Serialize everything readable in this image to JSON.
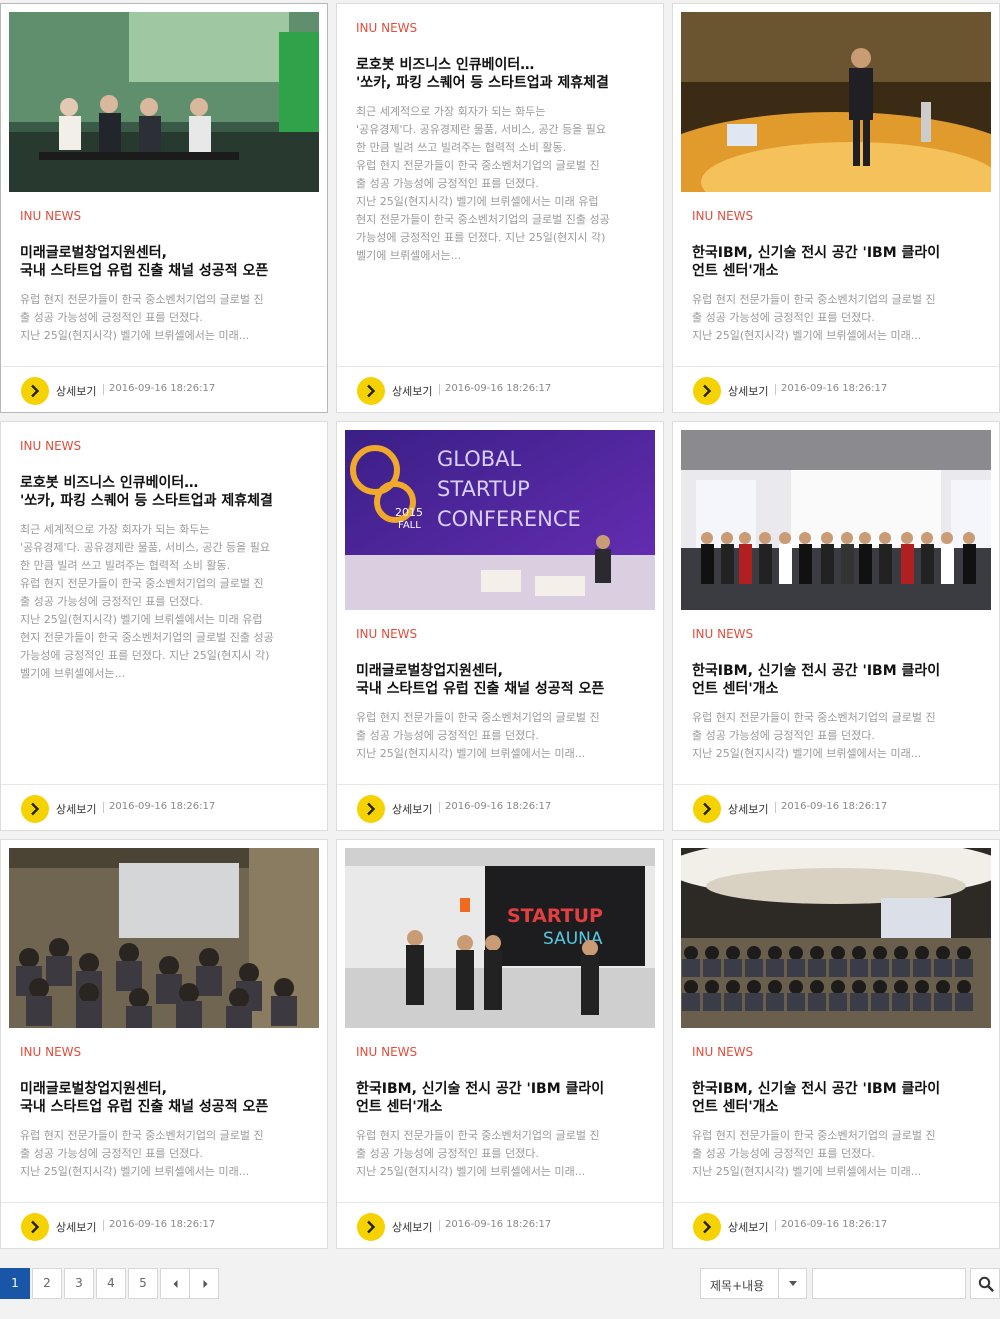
{
  "colors": {
    "accent": "#e24d3c",
    "more_button": "#f6d200",
    "pager_active": "#1a56a8"
  },
  "cards": [
    {
      "category": "INU NEWS",
      "title": [
        "미래글로벌창업지원센터,",
        "국내 스타트업 유럽 진출 채널 성공적 오픈"
      ],
      "desc": [
        "유럽 현지 전문가들이 한국 중소벤처기업의 글로벌 진",
        "출 성공 가능성에 긍정적인 표를 던졌다.",
        "지난 25일(현지시각) 벨기에 브뤼셀에서는 미래..."
      ],
      "more_label": "상세보기",
      "date": "2016-09-16 18:26:17",
      "image": "conference-panel-photo",
      "has_image": true
    },
    {
      "category": "INU NEWS",
      "title": [
        "로호봇 비즈니스 인큐베이터…",
        "'쏘카, 파킹 스퀘어 등 스타트업과 제휴체결"
      ],
      "desc": [
        "최근 세계적으로 가장 회자가 되는 화두는",
        "'공유경제'다. 공유경제란 물품, 서비스, 공간 등을 필요",
        "한 만큼 빌려 쓰고 빌려주는 협력적 소비 활동.",
        "유럽 현지 전문가들이 한국 중소벤처기업의 글로벌 진",
        "출 성공 가능성에 긍정적인 표를 던졌다.",
        "지난 25일(현지시각) 벨기에 브뤼셀에서는 미래 유럽",
        "현지 전문가들이 한국 중소벤처기업의 글로벌 진출 성공",
        "가능성에 긍정적인 표를 던졌다. 지난 25일(현지시 각)",
        "벨기에 브뤼셀에서는..."
      ],
      "more_label": "상세보기",
      "date": "2016-09-16 18:26:17",
      "has_image": false
    },
    {
      "category": "INU NEWS",
      "title": [
        "한국IBM, 신기술 전시 공간 'IBM 클라이",
        "언트 센터'개소"
      ],
      "desc": [
        "유럽 현지 전문가들이 한국 중소벤처기업의 글로벌 진",
        "출 성공 가능성에 긍정적인 표를 던졌다.",
        "지난 25일(현지시각) 벨기에 브뤼셀에서는 미래..."
      ],
      "more_label": "상세보기",
      "date": "2016-09-16 18:26:17",
      "image": "speaker-stage-photo",
      "has_image": true
    },
    {
      "category": "INU NEWS",
      "title": [
        "로호봇 비즈니스 인큐베이터…",
        "'쏘카, 파킹 스퀘어 등 스타트업과 제휴체결"
      ],
      "desc": [
        "최근 세계적으로 가장 회자가 되는 화두는",
        "'공유경제'다. 공유경제란 물품, 서비스, 공간 등을 필요",
        "한 만큼 빌려 쓰고 빌려주는 협력적 소비 활동.",
        "유럽 현지 전문가들이 한국 중소벤처기업의 글로벌 진",
        "출 성공 가능성에 긍정적인 표를 던졌다.",
        "지난 25일(현지시각) 벨기에 브뤼셀에서는 미래 유럽",
        "현지 전문가들이 한국 중소벤처기업의 글로벌 진출 성공",
        "가능성에 긍정적인 표를 던졌다. 지난 25일(현지시 각)",
        "벨기에 브뤼셀에서는..."
      ],
      "more_label": "상세보기",
      "date": "2016-09-16 18:26:17",
      "has_image": false
    },
    {
      "category": "INU NEWS",
      "title": [
        "미래글로벌창업지원센터,",
        "국내 스타트업 유럽 진출 채널 성공적 오픈"
      ],
      "desc": [
        "유럽 현지 전문가들이 한국 중소벤처기업의 글로벌 진",
        "출 성공 가능성에 긍정적인 표를 던졌다.",
        "지난 25일(현지시각) 벨기에 브뤼셀에서는 미래..."
      ],
      "more_label": "상세보기",
      "date": "2016-09-16 18:26:17",
      "image": "global-startup-conference-photo",
      "has_image": true,
      "image_text": {
        "line1": "GLOBAL",
        "line2": "STARTUP",
        "line3": "CONFERENCE",
        "year": "2015",
        "season": "FALL"
      }
    },
    {
      "category": "INU NEWS",
      "title": [
        "한국IBM, 신기술 전시 공간 'IBM 클라이",
        "언트 센터'개소"
      ],
      "desc": [
        "유럽 현지 전문가들이 한국 중소벤처기업의 글로벌 진",
        "출 성공 가능성에 긍정적인 표를 던졌다.",
        "지난 25일(현지시각) 벨기에 브뤼셀에서는 미래..."
      ],
      "more_label": "상세보기",
      "date": "2016-09-16 18:26:17",
      "image": "tencent-group-photo",
      "has_image": true
    },
    {
      "category": "INU NEWS",
      "title": [
        "미래글로벌창업지원센터,",
        "국내 스타트업 유럽 진출 채널 성공적 오픈"
      ],
      "desc": [
        "유럽 현지 전문가들이 한국 중소벤처기업의 글로벌 진",
        "출 성공 가능성에 긍정적인 표를 던졌다.",
        "지난 25일(현지시각) 벨기에 브뤼셀에서는 미래..."
      ],
      "more_label": "상세보기",
      "date": "2016-09-16 18:26:17",
      "image": "seminar-audience-photo",
      "has_image": true
    },
    {
      "category": "INU NEWS",
      "title": [
        "한국IBM, 신기술 전시 공간 'IBM 클라이",
        "언트 센터'개소"
      ],
      "desc": [
        "유럽 현지 전문가들이 한국 중소벤처기업의 글로벌 진",
        "출 성공 가능성에 긍정적인 표를 던졌다.",
        "지난 25일(현지시각) 벨기에 브뤼셀에서는 미래..."
      ],
      "more_label": "상세보기",
      "date": "2016-09-16 18:26:17",
      "image": "startup-sauna-photo",
      "has_image": true,
      "image_text": {
        "line1": "STARTUP",
        "line2": "SAUNA"
      }
    },
    {
      "category": "INU NEWS",
      "title": [
        "한국IBM, 신기술 전시 공간 'IBM 클라이",
        "언트 센터'개소"
      ],
      "desc": [
        "유럽 현지 전문가들이 한국 중소벤처기업의 글로벌 진",
        "출 성공 가능성에 긍정적인 표를 던졌다.",
        "지난 25일(현지시각) 벨기에 브뤼셀에서는 미래..."
      ],
      "more_label": "상세보기",
      "date": "2016-09-16 18:26:17",
      "image": "lecture-hall-photo",
      "has_image": true
    }
  ],
  "pagination": {
    "pages": [
      "1",
      "2",
      "3",
      "4",
      "5"
    ],
    "current": "1",
    "prev_icon": "chevron-left-icon",
    "next_icon": "chevron-right-icon"
  },
  "search": {
    "scope_selected": "제목+내용",
    "value": "",
    "placeholder": "",
    "button_icon": "search-icon"
  }
}
